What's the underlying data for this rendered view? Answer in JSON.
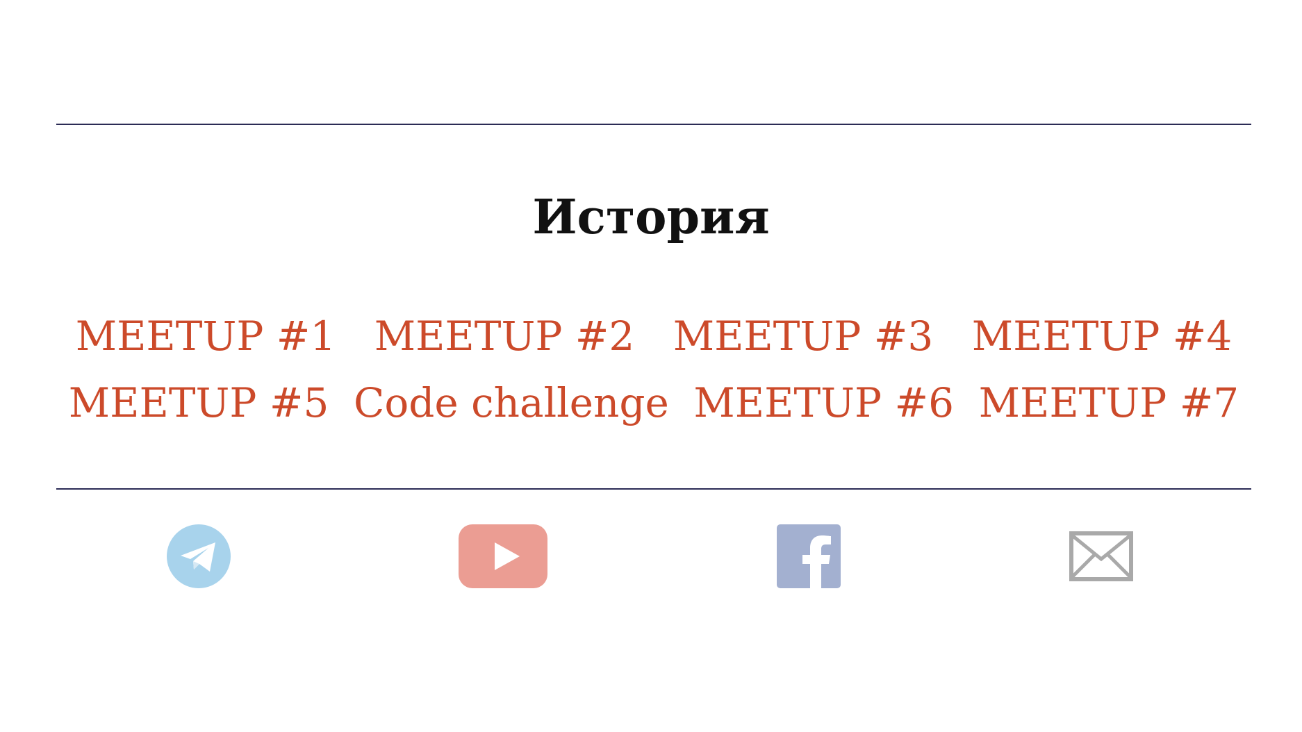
{
  "history": {
    "title": "История",
    "links": [
      [
        "MEETUP #1",
        "MEETUP #2",
        "MEETUP #3",
        "MEETUP #4"
      ],
      [
        "MEETUP #5",
        "Code challenge",
        "MEETUP #6",
        "MEETUP #7"
      ]
    ]
  },
  "social": {
    "icons": [
      "telegram-icon",
      "youtube-icon",
      "facebook-icon",
      "email-icon"
    ],
    "colors": {
      "telegram": "#a8d3ec",
      "youtube": "#eb9d93",
      "facebook": "#a3b0d0",
      "email": "#a9a9a9"
    }
  },
  "colors": {
    "link": "#cc4a2a",
    "divider": "#2b2b55",
    "title": "#111111"
  }
}
